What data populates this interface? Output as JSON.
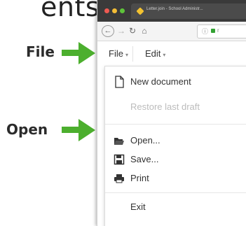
{
  "heading_fragment": "ents",
  "browser": {
    "tab_title": "Letter.join - School Administr...",
    "url_text": "r"
  },
  "menubar": {
    "file": "File",
    "edit": "Edit"
  },
  "file_menu": {
    "items": [
      {
        "label": "New document",
        "icon": "file-icon",
        "enabled": true
      },
      {
        "label": "Restore last draft",
        "icon": "",
        "enabled": false
      },
      {
        "label": "Open...",
        "icon": "open-folder-icon",
        "enabled": true
      },
      {
        "label": "Save...",
        "icon": "floppy-disk-icon",
        "enabled": true
      },
      {
        "label": "Print",
        "icon": "printer-icon",
        "enabled": true
      },
      {
        "label": "Exit",
        "icon": "",
        "enabled": true
      }
    ]
  },
  "annotations": {
    "file_label": "File",
    "open_label": "Open"
  },
  "colors": {
    "arrow": "#4caf2e",
    "titlebar": "#3a3a3a",
    "disabled_text": "#bcbcbc"
  }
}
